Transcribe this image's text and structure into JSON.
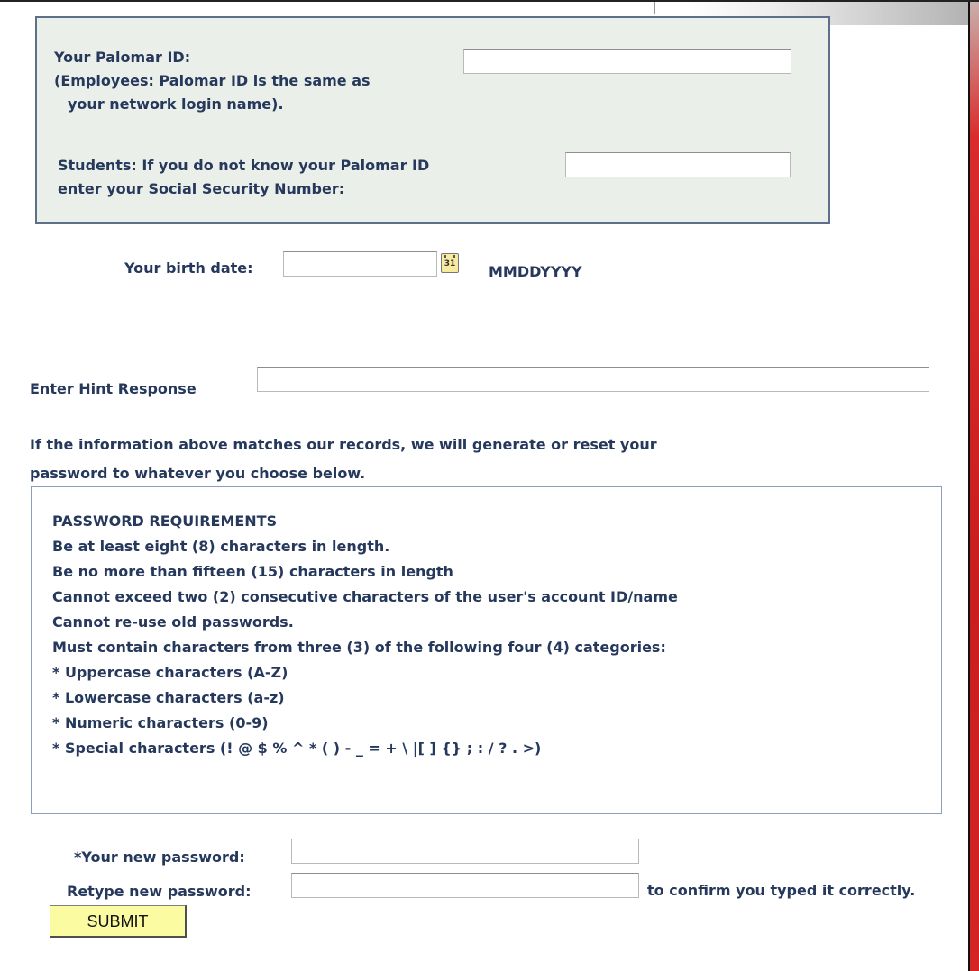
{
  "identity": {
    "palomar_id_label": "Your Palomar ID:",
    "palomar_id_note_1": "(Employees: Palomar ID is the same as",
    "palomar_id_note_2": "your network login name).",
    "palomar_id_value": "",
    "ssn_label_1": "Students: If you do not know your Palomar ID",
    "ssn_label_2": "enter your Social Security Number:",
    "ssn_value": ""
  },
  "birth": {
    "label": "Your birth date:",
    "value": "",
    "calendar_glyph": "31",
    "format_hint": "MMDDYYYY"
  },
  "hint": {
    "label": "Enter Hint Response",
    "value": ""
  },
  "info_text_1": "If the information above matches our records, we will generate or reset your",
  "info_text_2": "password to whatever you choose below.",
  "requirements": {
    "title": "PASSWORD REQUIREMENTS",
    "items": [
      "Be at least eight (8) characters in length.",
      "Be no more than fifteen (15) characters in length",
      "Cannot exceed two (2) consecutive characters of the user's account ID/name",
      "Cannot re-use old passwords.",
      "Must contain characters from three (3) of the following four (4) categories:",
      "* Uppercase characters (A-Z)",
      "* Lowercase characters (a-z)",
      "* Numeric characters (0-9)",
      "* Special characters (! @ $ % ^ * ( ) - _ = + \\ |[ ] {} ; : / ? . >)"
    ]
  },
  "password": {
    "new_label": "*Your new password:",
    "new_value": "",
    "retype_label": "Retype new password:",
    "retype_value": "",
    "confirm_note": "to confirm you typed it correctly."
  },
  "submit_label": "SUBMIT"
}
